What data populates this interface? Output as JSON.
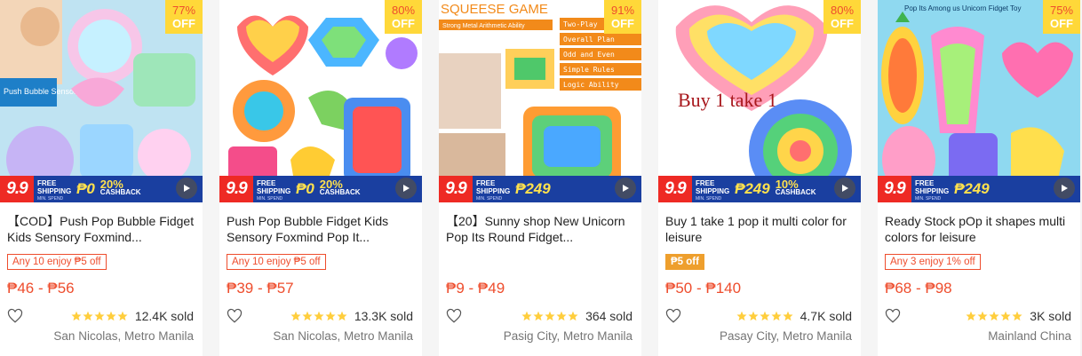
{
  "colors": {
    "accent": "#ee4d2d",
    "star": "#ffce3d",
    "badge_yellow": "#ffd839",
    "promo_blue": "#1a3fa0",
    "promo_red": "#ee2a24"
  },
  "products": [
    {
      "discount": "77%",
      "off_label": "OFF",
      "promo": {
        "nine": "9.9",
        "ship_label": "FREE SHIPPING",
        "ship_sub": "MIN. SPEND",
        "amount": "₱0",
        "cashback_pct": "20%",
        "cashback_label": "CASHBACK"
      },
      "title": "【COD】Push Pop Bubble Fidget Kids Sensory Foxmind...",
      "voucher": "Any 10 enjoy ₱5 off",
      "voucher_style": "outline",
      "price": "₱46 - ₱56",
      "rating": 5,
      "sold": "12.4K sold",
      "location": "San Nicolas, Metro Manila",
      "image_text": "Push Bubble Sensory Toy",
      "icons": [
        "heart-icon",
        "star-icon",
        "play-icon"
      ]
    },
    {
      "discount": "80%",
      "off_label": "OFF",
      "promo": {
        "nine": "9.9",
        "ship_label": "FREE SHIPPING",
        "ship_sub": "MIN. SPEND",
        "amount": "₱0",
        "cashback_pct": "20%",
        "cashback_label": "CASHBACK"
      },
      "title": "Push Pop Bubble Fidget Kids Sensory Foxmind Pop It...",
      "voucher": "Any 10 enjoy ₱5 off",
      "voucher_style": "outline",
      "price": "₱39 - ₱57",
      "rating": 5,
      "sold": "13.3K sold",
      "location": "San Nicolas, Metro Manila",
      "image_text": "",
      "icons": [
        "heart-icon",
        "star-icon",
        "play-icon"
      ]
    },
    {
      "discount": "91%",
      "off_label": "OFF",
      "promo": {
        "nine": "9.9",
        "ship_label": "FREE SHIPPING",
        "ship_sub": "MIN. SPEND",
        "amount": "₱249",
        "cashback_pct": "",
        "cashback_label": ""
      },
      "title": "【20】Sunny shop New Unicorn Pop Its Round Fidget...",
      "voucher": "",
      "voucher_style": "none",
      "price": "₱9 - ₱49",
      "rating": 5,
      "sold": "364 sold",
      "location": "Pasig City, Metro Manila",
      "image_text": "SQUEESE GAME",
      "image_sub": "Strong Metal Arithmetic Ability",
      "image_menu": [
        "Two-Play",
        "Overall Plan",
        "Odd and Even",
        "Simple Rules",
        "Logic Ability"
      ],
      "icons": [
        "heart-icon",
        "star-icon",
        "play-icon"
      ]
    },
    {
      "discount": "80%",
      "off_label": "OFF",
      "promo": {
        "nine": "9.9",
        "ship_label": "FREE SHIPPING",
        "ship_sub": "MIN. SPEND",
        "amount": "₱249",
        "cashback_pct": "10%",
        "cashback_label": "CASHBACK"
      },
      "title": "Buy 1 take 1 pop it multi color for leisure",
      "voucher": "₱5 off",
      "voucher_style": "solid",
      "price": "₱50 - ₱140",
      "rating": 5,
      "sold": "4.7K sold",
      "location": "Pasay City, Metro Manila",
      "image_text": "Buy 1 take 1",
      "icons": [
        "heart-icon",
        "star-icon",
        "play-icon"
      ]
    },
    {
      "discount": "75%",
      "off_label": "OFF",
      "promo": {
        "nine": "9.9",
        "ship_label": "FREE SHIPPING",
        "ship_sub": "MIN. SPEND",
        "amount": "₱249",
        "cashback_pct": "",
        "cashback_label": ""
      },
      "title": "Ready Stock pOp it shapes multi colors for leisure",
      "voucher": "Any 3 enjoy 1% off",
      "voucher_style": "outline",
      "price": "₱68 - ₱98",
      "rating": 5,
      "sold": "3K sold",
      "location": "Mainland China",
      "image_text": "Pop Its Among us Unicorn Fidget Toy",
      "icons": [
        "heart-icon",
        "star-icon",
        "play-icon"
      ]
    }
  ]
}
